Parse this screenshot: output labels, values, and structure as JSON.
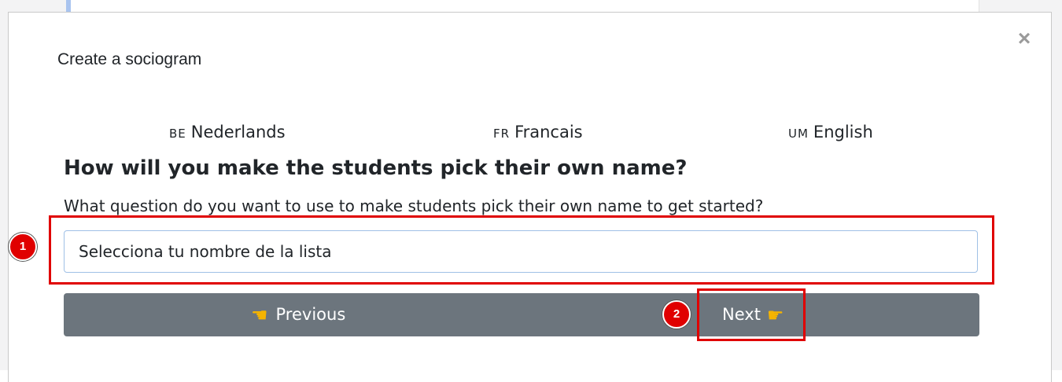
{
  "modal": {
    "title": "Create a sociogram",
    "close_glyph": "×"
  },
  "languages": [
    {
      "code": "BE",
      "label": "Nederlands"
    },
    {
      "code": "FR",
      "label": "Francais"
    },
    {
      "code": "UM",
      "label": "English"
    }
  ],
  "question": {
    "heading": "How will you make the students pick their own name?",
    "subheading": "What question do you want to use to make students pick their own name to get started?",
    "input_value": "Selecciona tu nombre de la lista"
  },
  "navigation": {
    "previous_label": "Previous",
    "next_label": "Next",
    "previous_icon": "pointing-left-hand-icon",
    "next_icon": "pointing-right-hand-icon"
  },
  "annotations": [
    {
      "label": "1"
    },
    {
      "label": "2"
    }
  ],
  "colors": {
    "annotation_red": "#e00000",
    "nav_bar": "#6c757d",
    "input_border": "#9fc0e6"
  }
}
